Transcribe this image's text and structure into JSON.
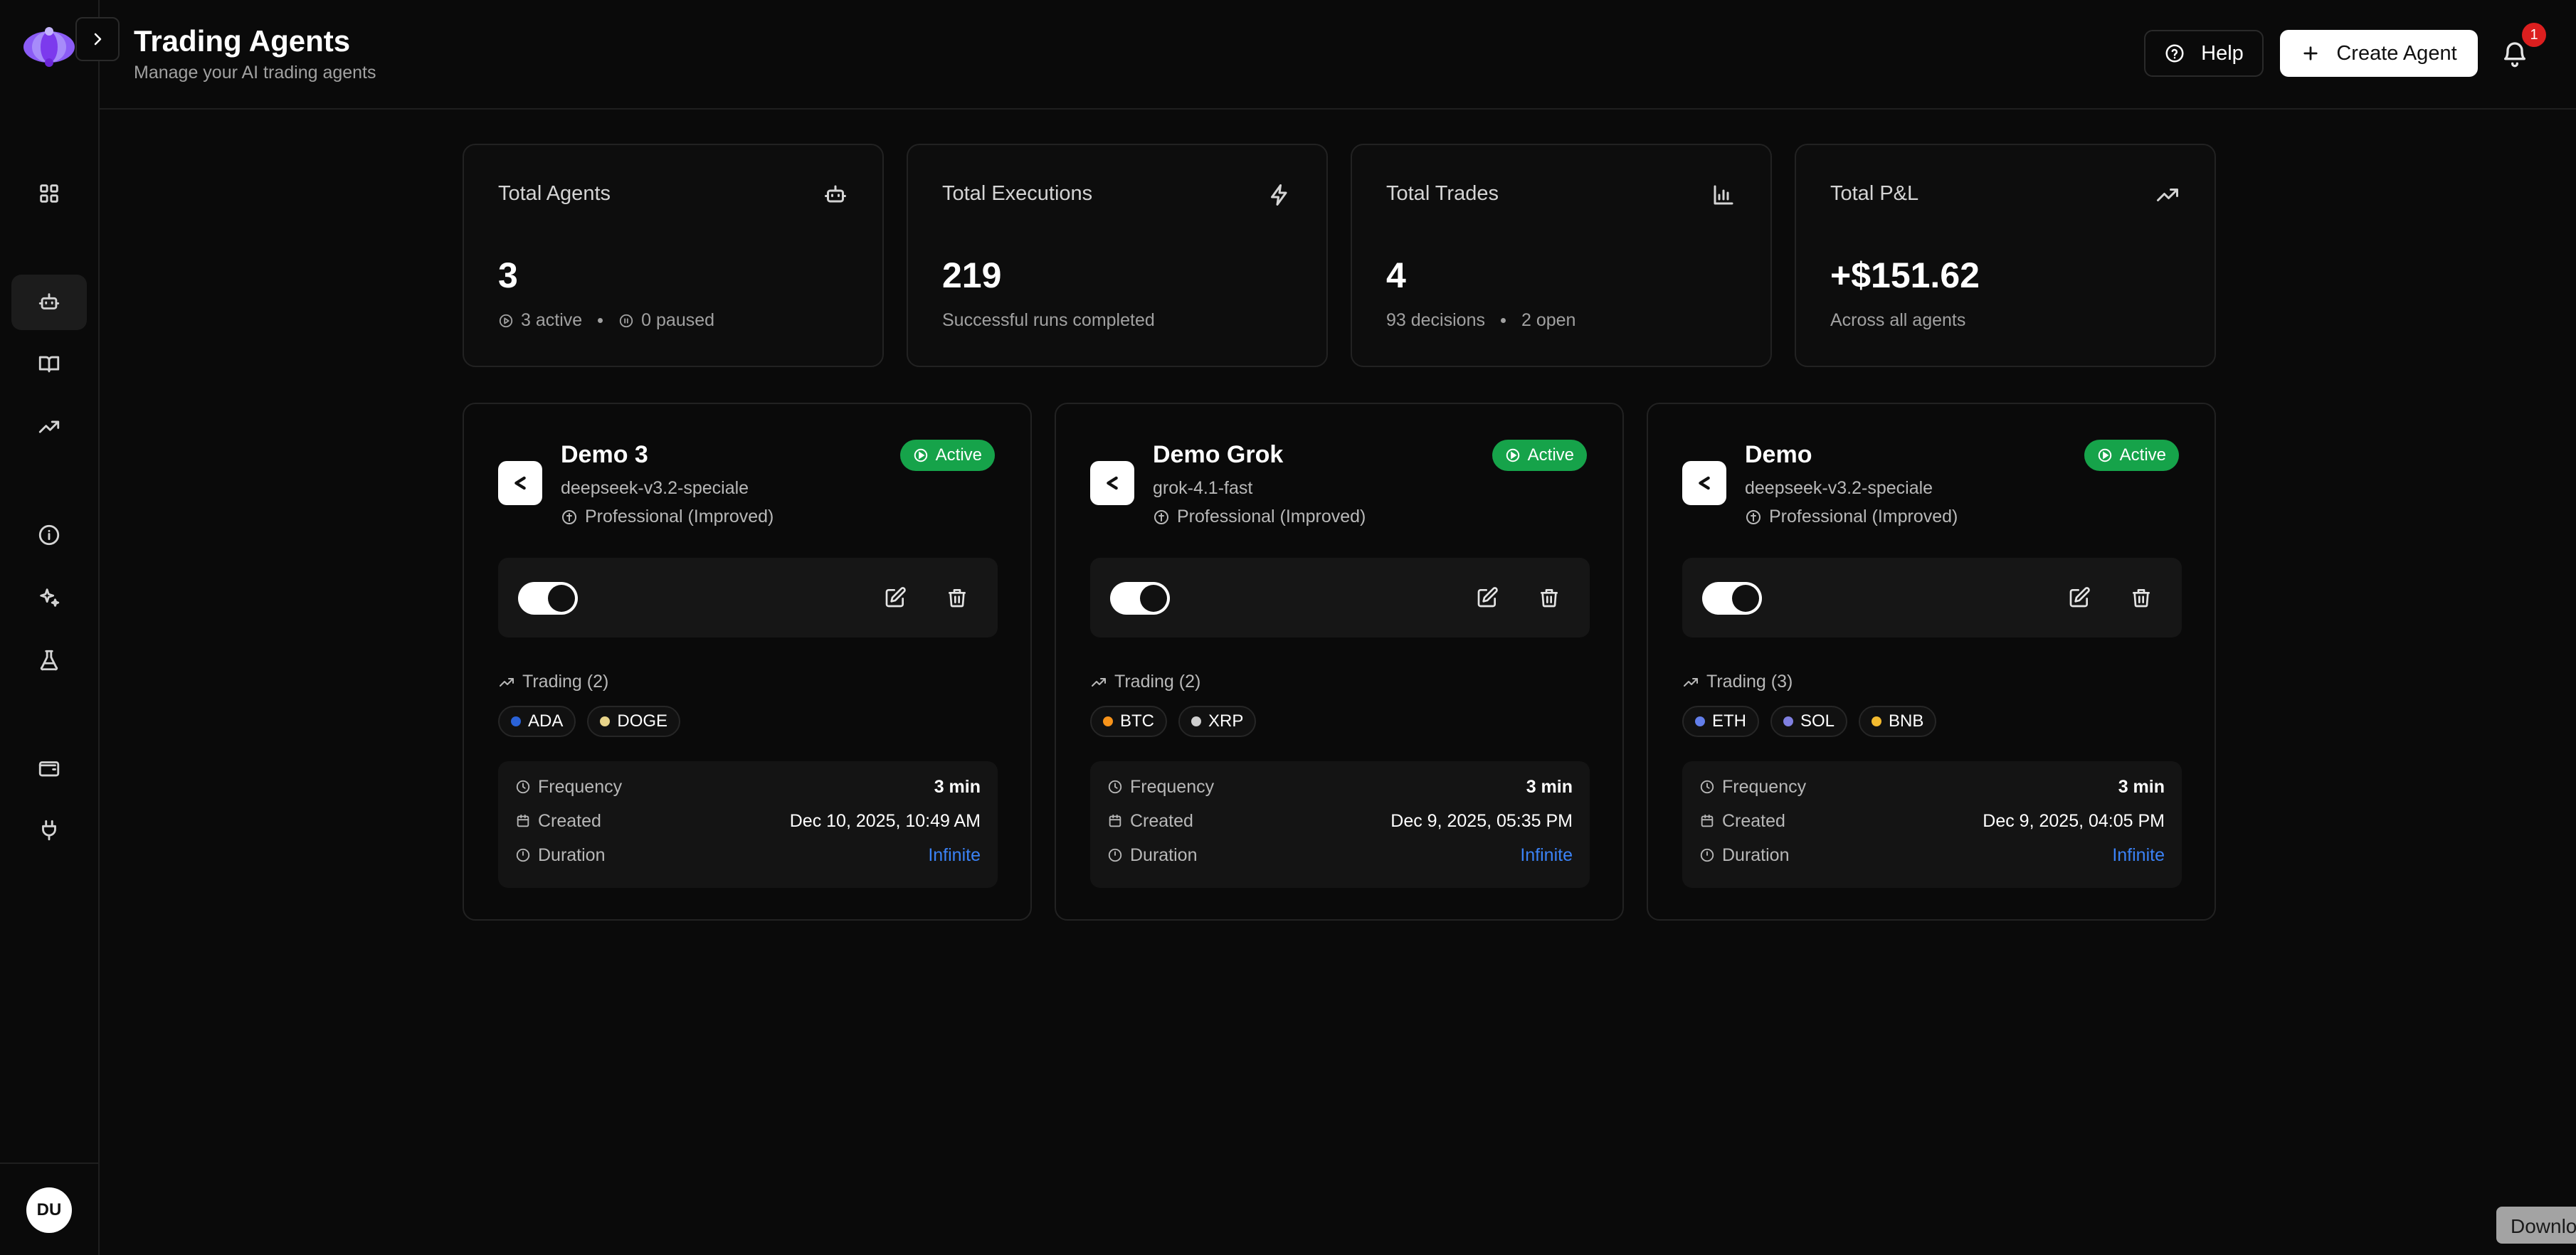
{
  "header": {
    "title": "Trading Agents",
    "subtitle": "Manage your AI trading agents",
    "help_label": "Help",
    "create_label": "Create Agent",
    "notification_count": "1"
  },
  "sidebar": {
    "items": [
      {
        "icon": "dashboard-grid-icon"
      },
      {
        "icon": "robot-icon",
        "active": true
      },
      {
        "icon": "book-open-icon"
      },
      {
        "icon": "trending-up-icon"
      },
      {
        "icon": "info-icon"
      },
      {
        "icon": "sparkles-icon"
      },
      {
        "icon": "flask-icon"
      },
      {
        "icon": "wallet-icon"
      },
      {
        "icon": "plug-icon"
      }
    ],
    "avatar_initials": "DU"
  },
  "stats": [
    {
      "label": "Total Agents",
      "value": "3",
      "sub_a": "3 active",
      "sub_b": "0 paused",
      "icon": "robot-icon"
    },
    {
      "label": "Total Executions",
      "value": "219",
      "sub_a": "Successful runs completed",
      "icon": "zap-icon"
    },
    {
      "label": "Total Trades",
      "value": "4",
      "sub_a": "93 decisions",
      "sub_b": "2 open",
      "icon": "bar-chart-icon"
    },
    {
      "label": "Total P&L",
      "value": "+$151.62",
      "sub_a": "Across all agents",
      "icon": "trending-up-icon"
    }
  ],
  "agents": [
    {
      "name": "Demo 3",
      "model": "deepseek-v3.2-speciale",
      "profile": "Professional (Improved)",
      "status": "Active",
      "trading_label": "Trading (2)",
      "coins": [
        {
          "symbol": "ADA",
          "color": "#2a62d8"
        },
        {
          "symbol": "DOGE",
          "color": "#e8d48a"
        }
      ],
      "frequency_label": "Frequency",
      "frequency": "3 min",
      "created_label": "Created",
      "created": "Dec 10, 2025, 10:49 AM",
      "duration_label": "Duration",
      "duration": "Infinite"
    },
    {
      "name": "Demo Grok",
      "model": "grok-4.1-fast",
      "profile": "Professional (Improved)",
      "status": "Active",
      "trading_label": "Trading (2)",
      "coins": [
        {
          "symbol": "BTC",
          "color": "#f7931a"
        },
        {
          "symbol": "XRP",
          "color": "#cfcfcf"
        }
      ],
      "frequency_label": "Frequency",
      "frequency": "3 min",
      "created_label": "Created",
      "created": "Dec 9, 2025, 05:35 PM",
      "duration_label": "Duration",
      "duration": "Infinite"
    },
    {
      "name": "Demo",
      "model": "deepseek-v3.2-speciale",
      "profile": "Professional (Improved)",
      "status": "Active",
      "trading_label": "Trading (3)",
      "coins": [
        {
          "symbol": "ETH",
          "color": "#627eea"
        },
        {
          "symbol": "SOL",
          "color": "#7f7fe0"
        },
        {
          "symbol": "BNB",
          "color": "#f3ba2f"
        }
      ],
      "frequency_label": "Frequency",
      "frequency": "3 min",
      "created_label": "Created",
      "created": "Dec 9, 2025, 04:05 PM",
      "duration_label": "Duration",
      "duration": "Infinite"
    }
  ],
  "download_label": "Download",
  "colors": {
    "accent_logo": "#8b5cf6",
    "active_green": "#16a34a",
    "link_blue": "#3b82f6",
    "badge_red": "#dc1f1f"
  }
}
